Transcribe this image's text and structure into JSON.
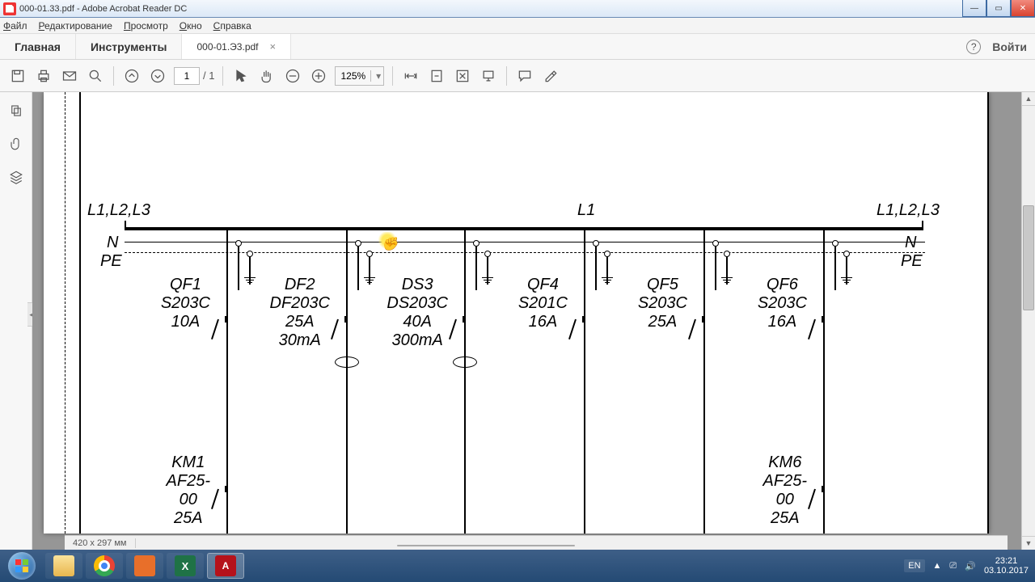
{
  "window": {
    "title": "000-01.33.pdf - Adobe Acrobat Reader DC"
  },
  "menu": {
    "file": "Файл",
    "edit": "Редактирование",
    "view": "Просмотр",
    "window": "Окно",
    "help": "Справка"
  },
  "tabs": {
    "home": "Главная",
    "tools": "Инструменты",
    "doc": "000-01.Э3.pdf",
    "login": "Войти"
  },
  "toolbar": {
    "page_current": "1",
    "page_total": "/ 1",
    "zoom": "125%"
  },
  "status": {
    "size": "420 x 297 мм"
  },
  "schematic": {
    "left_phase": "L1,L2,L3",
    "mid_phase": "L1",
    "right_phase": "L1,L2,L3",
    "n": "N",
    "pe": "PE",
    "branches": [
      {
        "id": "QF1",
        "model": "S203C",
        "rating": "10A",
        "km": "KM1",
        "km_model": "AF25-00",
        "km_rating": "25A"
      },
      {
        "id": "DF2",
        "model": "DF203C",
        "rating": "25A",
        "leak": "30mA"
      },
      {
        "id": "DS3",
        "model": "DS203C",
        "rating": "40A",
        "leak": "300mA"
      },
      {
        "id": "QF4",
        "model": "S201C",
        "rating": "16A"
      },
      {
        "id": "QF5",
        "model": "S203C",
        "rating": "25A"
      },
      {
        "id": "QF6",
        "model": "S203C",
        "rating": "16A",
        "km": "KM6",
        "km_model": "AF25-00",
        "km_rating": "25A"
      }
    ]
  },
  "tray": {
    "lang": "EN",
    "time": "23:21",
    "date": "03.10.2017"
  }
}
